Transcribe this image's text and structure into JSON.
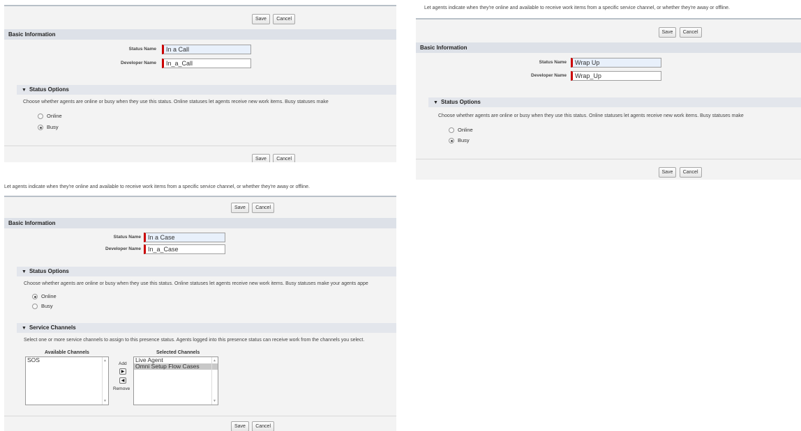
{
  "common": {
    "save_label": "Save",
    "cancel_label": "Cancel",
    "basic_info": "Basic Information",
    "status_name_label": "Status Name",
    "developer_name_label": "Developer Name",
    "status_options": "Status Options",
    "online": "Online",
    "busy": "Busy"
  },
  "panel_call": {
    "status_name": "In a Call",
    "developer_name": "In_a_Call",
    "help": "Choose whether agents are online or busy when they use this status. Online statuses let agents receive new work items. Busy statuses make",
    "selected": "Busy"
  },
  "panel_wrap": {
    "description": "Let agents indicate when they're online and available to receive work items from a specific service channel, or whether they're away or offline.",
    "status_name": "Wrap Up",
    "developer_name": "Wrap_Up",
    "help": "Choose whether agents are online or busy when they use this status. Online statuses let agents receive new work items. Busy statuses make",
    "selected": "Busy"
  },
  "panel_case": {
    "description": "Let agents indicate when they're online and available to receive work items from a specific service channel, or whether they're away or offline.",
    "status_name": "In a Case",
    "developer_name": "In_a_Case",
    "help": "Choose whether agents are online or busy when they use this status. Online statuses let agents receive new work items. Busy statuses make your agents appe",
    "selected": "Online",
    "service_channels": {
      "title": "Service Channels",
      "help": "Select one or more service channels to assign to this presence status. Agents logged into this presence status can receive work from the channels you select.",
      "available_label": "Available Channels",
      "selected_label": "Selected Channels",
      "add_label": "Add",
      "remove_label": "Remove",
      "available": [
        "SOS"
      ],
      "selected_items": [
        "Live Agent",
        "Omni Setup Flow Cases"
      ]
    }
  },
  "colors": {
    "section_bar": "#dde1e8",
    "required_marker": "#cc0000",
    "panel_bg": "#f3f3f3"
  }
}
